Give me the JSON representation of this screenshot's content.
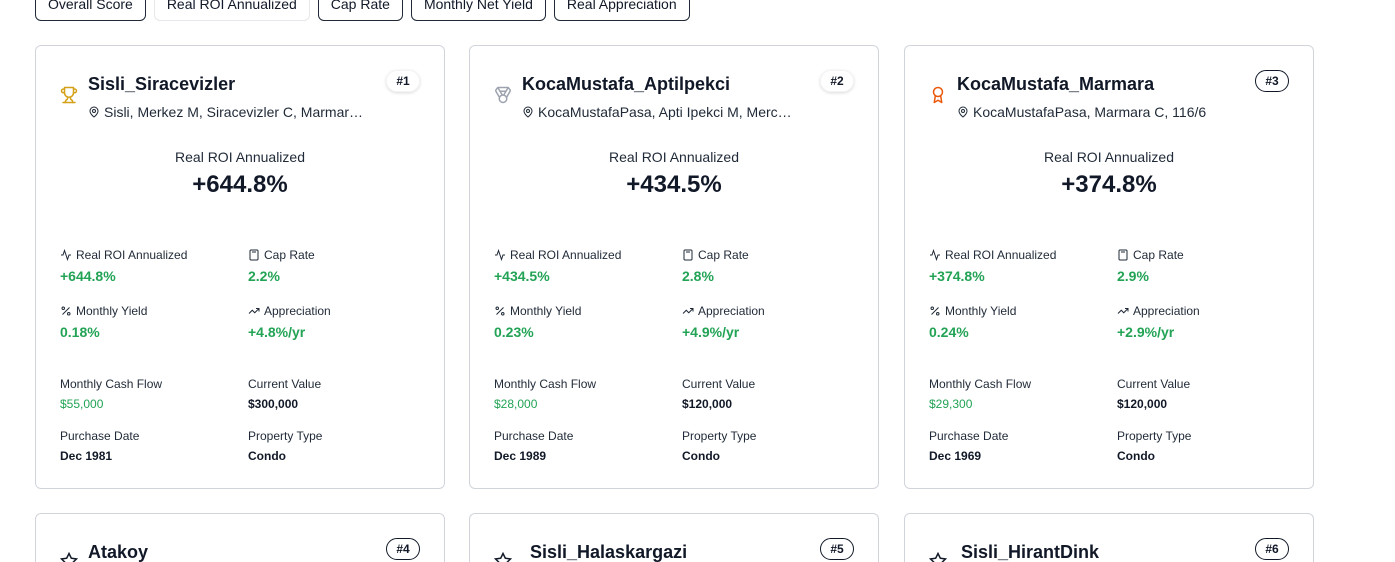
{
  "tabs": [
    {
      "label": "Overall Score"
    },
    {
      "label": "Real ROI Annualized"
    },
    {
      "label": "Cap Rate"
    },
    {
      "label": "Monthly Net Yield"
    },
    {
      "label": "Real Appreciation"
    }
  ],
  "labels": {
    "hero": "Real ROI Annualized",
    "roi": "Real ROI Annualized",
    "cap_rate": "Cap Rate",
    "monthly_yield": "Monthly Yield",
    "appreciation": "Appreciation",
    "cash_flow": "Monthly Cash Flow",
    "current_value": "Current Value",
    "purchase_date": "Purchase Date",
    "property_type": "Property Type"
  },
  "colors": {
    "positive": "#22a355",
    "gold": "#d4a017",
    "silver": "#9ca3af",
    "bronze": "#ea580c"
  },
  "cards": [
    {
      "rank": "#1",
      "icon": "trophy-icon",
      "name": "Sisli_Siracevizler",
      "address": "Sisli, Merkez M, Siracevizler C, Marmar…",
      "hero_value": "+644.8%",
      "roi": "+644.8%",
      "cap_rate": "2.2%",
      "monthly_yield": "0.18%",
      "appreciation": "+4.8%/yr",
      "cash_flow": "$55,000",
      "current_value": "$300,000",
      "purchase_date": "Dec 1981",
      "property_type": "Condo"
    },
    {
      "rank": "#2",
      "icon": "medal-icon",
      "name": "KocaMustafa_Aptilpekci",
      "address": "KocaMustafaPasa, Apti Ipekci M, Merc…",
      "hero_value": "+434.5%",
      "roi": "+434.5%",
      "cap_rate": "2.8%",
      "monthly_yield": "0.23%",
      "appreciation": "+4.9%/yr",
      "cash_flow": "$28,000",
      "current_value": "$120,000",
      "purchase_date": "Dec 1989",
      "property_type": "Condo"
    },
    {
      "rank": "#3",
      "icon": "award-icon",
      "name": "KocaMustafa_Marmara",
      "address": "KocaMustafaPasa, Marmara C, 116/6",
      "hero_value": "+374.8%",
      "roi": "+374.8%",
      "cap_rate": "2.9%",
      "monthly_yield": "0.24%",
      "appreciation": "+2.9%/yr",
      "cash_flow": "$29,300",
      "current_value": "$120,000",
      "purchase_date": "Dec 1969",
      "property_type": "Condo"
    },
    {
      "rank": "#4",
      "icon": "star-icon",
      "name": "Atakoy"
    },
    {
      "rank": "#5",
      "icon": "star-icon",
      "name": "Sisli_Halaskargazi"
    },
    {
      "rank": "#6",
      "icon": "star-icon",
      "name": "Sisli_HirantDink"
    }
  ]
}
